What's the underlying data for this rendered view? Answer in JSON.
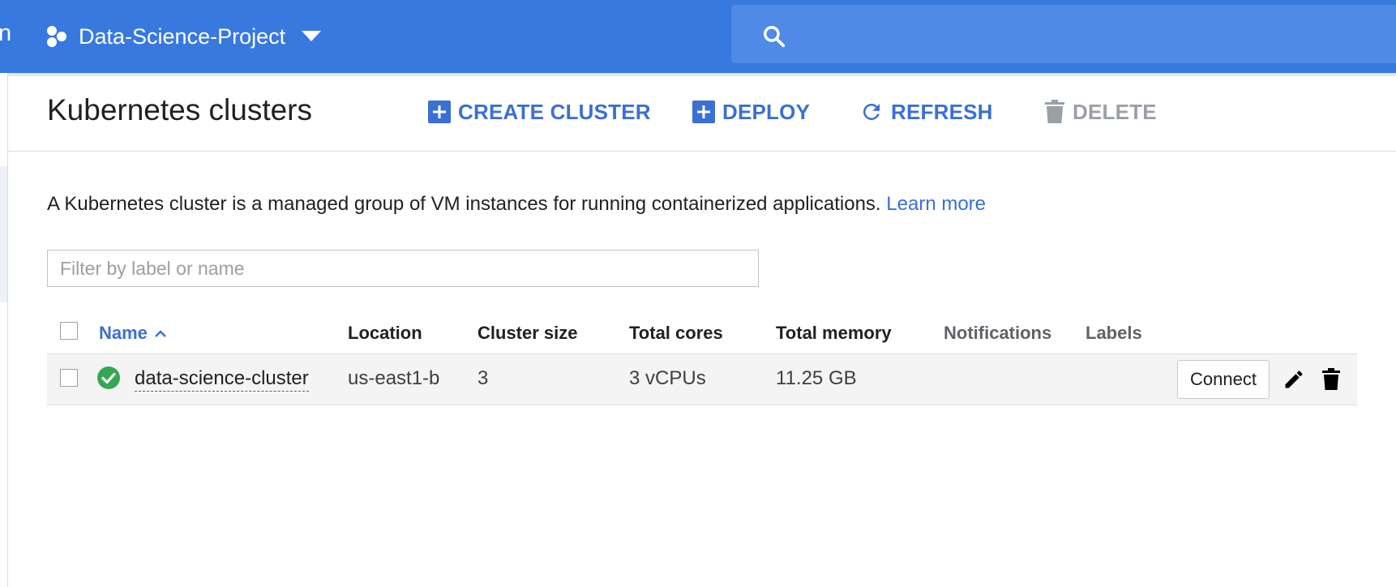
{
  "topbar": {
    "left_glyph": "n",
    "project_name": "Data-Science-Project",
    "search_placeholder": ""
  },
  "header": {
    "title": "Kubernetes clusters",
    "actions": {
      "create_cluster": "CREATE CLUSTER",
      "deploy": "DEPLOY",
      "refresh": "REFRESH",
      "delete": "DELETE"
    }
  },
  "description": {
    "text": "A Kubernetes cluster is a managed group of VM instances for running containerized applications. ",
    "link": "Learn more"
  },
  "filter": {
    "placeholder": "Filter by label or name",
    "value": ""
  },
  "table": {
    "columns": [
      "Name",
      "Location",
      "Cluster size",
      "Total cores",
      "Total memory",
      "Notifications",
      "Labels"
    ],
    "sorted_column": "Name",
    "sort_direction": "ascending",
    "rows": [
      {
        "status": "ok",
        "name": "data-science-cluster",
        "location": "us-east1-b",
        "cluster_size": "3",
        "total_cores": "3 vCPUs",
        "total_memory": "11.25 GB",
        "notifications": "",
        "labels": "",
        "connect_label": "Connect"
      }
    ]
  },
  "colors": {
    "topbar": "#3879e0",
    "accent": "#3b6fd4",
    "status_ok": "#34a853",
    "disabled": "#9aa0a6"
  },
  "icons": {
    "project": "project-hexagons-icon",
    "dropdown": "caret-down-icon",
    "search": "search-icon",
    "create": "add-box-icon",
    "deploy": "add-box-icon",
    "refresh": "refresh-icon",
    "delete": "trash-icon",
    "sort": "chevron-up-icon",
    "status": "check-circle-icon",
    "edit": "pencil-icon",
    "row_delete": "trash-icon"
  }
}
